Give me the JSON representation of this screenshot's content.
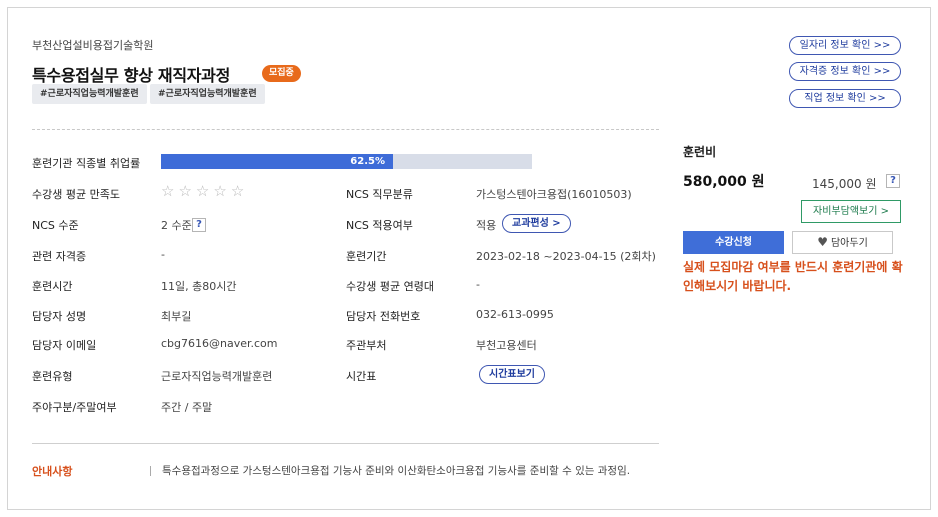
{
  "institution": "부천산업설비용접기술학원",
  "course_title": "특수용접실무 향상 재직자과정",
  "status_badge": "모집중",
  "tags": [
    "#근로자직업능력개발훈련",
    "#근로자직업능력개발훈련"
  ],
  "side_buttons": [
    "일자리 정보 확인 >>",
    "자격증 정보 확인 >>",
    "직업 정보 확인 >>"
  ],
  "employment_rate": {
    "label": "훈련기관 직종별 취업률",
    "percent": 62.5,
    "text": "62.5%"
  },
  "satisfaction": {
    "label": "수강생 평균 만족도",
    "rating": 0,
    "max": 5,
    "star_glyph": "☆"
  },
  "left_fields": [
    {
      "label": "NCS 수준",
      "value": "2 수준"
    },
    {
      "label": "관련 자격증",
      "value": "-"
    },
    {
      "label": "훈련시간",
      "value": "11일, 총80시간"
    },
    {
      "label": "담당자 성명",
      "value": "최부길"
    },
    {
      "label": "담당자 이메일",
      "value": "cbg7616@naver.com"
    },
    {
      "label": "훈련유형",
      "value": "근로자직업능력개발훈련"
    },
    {
      "label": "주야구분/주말여부",
      "value": "주간 / 주말"
    }
  ],
  "right_fields": [
    {
      "label": "NCS 직무분류",
      "value": "가스텅스텐아크용접(16010503)"
    },
    {
      "label": "NCS 적용여부",
      "value": "적용"
    },
    {
      "label": "훈련기간",
      "value": "2023-02-18 ~2023-04-15 (2회차)"
    },
    {
      "label": "수강생 평균 연령대",
      "value": "-"
    },
    {
      "label": "담당자 전화번호",
      "value": "032-613-0995"
    },
    {
      "label": "주관부처",
      "value": "부천고용센터"
    },
    {
      "label": "시간표",
      "value": ""
    }
  ],
  "curriculum_button": "교과편성 >",
  "schedule_button": "시간표보기",
  "help_glyph": "?",
  "fee": {
    "label": "훈련비",
    "main": "580,000 원",
    "self_pay": "145,000 원",
    "self_pay_button": "자비부담액보기 >",
    "apply_button": "수강신청",
    "favorite_button": "담아두기",
    "heart_glyph": "♥",
    "notice": "실제 모집마감 여부를 반드시 훈련기관에 확인해보시기 바랍니다."
  },
  "guide": {
    "label": "안내사항",
    "text": "특수용접과정으로 가스텅스텐아크용접 기능사 준비와 이산화탄소아크용접 기능사를 준비할 수 있는 과정임."
  },
  "colors": {
    "accent_blue": "#3e6cd8",
    "badge_orange": "#e86a1b",
    "notice_red": "#d7501c",
    "self_pay_green": "#2f9a66"
  }
}
